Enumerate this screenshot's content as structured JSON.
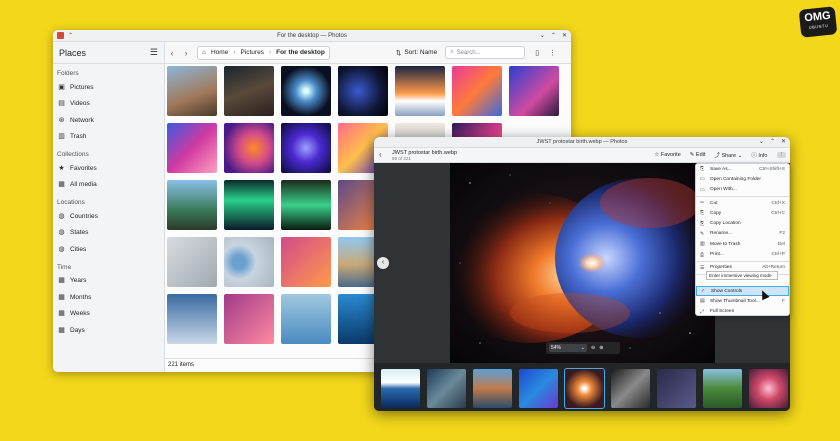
{
  "logo": {
    "line1": "OMG",
    "line2": "UBUNTU"
  },
  "window1": {
    "title": "For the desktop — Photos",
    "sidebar": {
      "title": "Places",
      "sections": [
        {
          "label": "Folders",
          "items": [
            {
              "label": "Pictures",
              "icon": "picture-icon"
            },
            {
              "label": "Videos",
              "icon": "video-icon"
            },
            {
              "label": "Network",
              "icon": "network-icon"
            },
            {
              "label": "Trash",
              "icon": "trash-icon"
            }
          ]
        },
        {
          "label": "Collections",
          "items": [
            {
              "label": "Favorites",
              "icon": "star-icon"
            },
            {
              "label": "All media",
              "icon": "media-icon"
            }
          ]
        },
        {
          "label": "Locations",
          "items": [
            {
              "label": "Countries",
              "icon": "globe-icon"
            },
            {
              "label": "States",
              "icon": "globe-icon"
            },
            {
              "label": "Cities",
              "icon": "globe-icon"
            }
          ]
        },
        {
          "label": "Time",
          "items": [
            {
              "label": "Years",
              "icon": "calendar-icon"
            },
            {
              "label": "Months",
              "icon": "calendar-icon"
            },
            {
              "label": "Weeks",
              "icon": "calendar-icon"
            },
            {
              "label": "Days",
              "icon": "calendar-icon"
            }
          ]
        }
      ]
    },
    "breadcrumb": {
      "home": "Home",
      "pictures": "Pictures",
      "current": "For the desktop"
    },
    "sort_label": "Sort: Name",
    "search_placeholder": "Search...",
    "status": "221 items"
  },
  "window2": {
    "title": "JWST protostar birth.webp — Photos",
    "file_name": "JWST protostar birth.webp",
    "file_position": "89 of 221",
    "actions": {
      "favorite": "Favorite",
      "edit": "Edit",
      "share": "Share",
      "info": "Info"
    },
    "zoom": "54%",
    "menu": [
      {
        "label": "Save As...",
        "shortcut": "Ctrl+Shift+S"
      },
      {
        "label": "Open Containing Folder",
        "shortcut": ""
      },
      {
        "label": "Open With...",
        "shortcut": ""
      },
      {
        "label": "Cut",
        "shortcut": "Ctrl+X"
      },
      {
        "label": "Copy",
        "shortcut": "Ctrl+C"
      },
      {
        "label": "Copy Location",
        "shortcut": ""
      },
      {
        "label": "Rename...",
        "shortcut": "F2"
      },
      {
        "label": "Move to Trash",
        "shortcut": "Del"
      },
      {
        "label": "Print...",
        "shortcut": "Ctrl+P"
      },
      {
        "label": "Properties",
        "shortcut": "Alt+Return"
      },
      {
        "label": "Show Controls",
        "shortcut": ""
      },
      {
        "label": "Show Thumbnail Tool...",
        "shortcut": "F"
      },
      {
        "label": "Full Screen",
        "shortcut": ""
      }
    ],
    "tooltip": "Enter immersive viewing mode"
  }
}
